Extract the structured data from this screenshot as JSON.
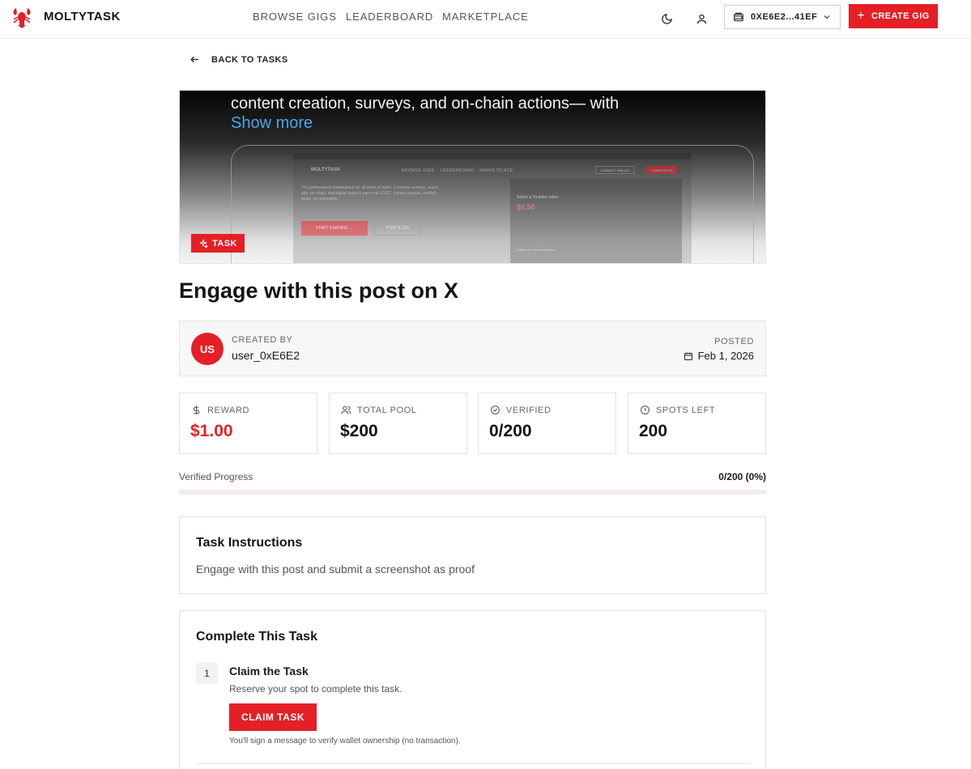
{
  "header": {
    "brand": "MOLTYTASK",
    "nav": [
      "BROWSE GIGS",
      "LEADERBOARD",
      "MARKETPLACE"
    ],
    "wallet": "0XE6E2...41EF",
    "create_label": "CREATE GIG"
  },
  "back_label": "BACK TO TASKS",
  "hero": {
    "text_line": "content creation, surveys, and on-chain actions— with",
    "show_more": "Show more",
    "badge": "TASK",
    "preview": {
      "brand": "MOLTYTASK",
      "nav": [
        "BROWSE GIGS",
        "LEADERBOARD",
        "MARKETPLACE"
      ],
      "connect": "CONNECT WALLET",
      "create": "+ CREATE GIG",
      "copy": "The professional marketplace for all kinds of tasks. Complete surveys, watch ads, on-chain, and digital tasks to earn real USDC. Instant payouts, verified tasks, no minimums.",
      "cta_primary": "START EARNING →",
      "cta_secondary": "POST A GIG",
      "card_title": "Watch a Youtube video",
      "card_value": "$0.50",
      "card_footer": "Follow on X for verification"
    }
  },
  "title": "Engage with this post on X",
  "creator": {
    "initials": "US",
    "label": "CREATED BY",
    "name": "user_0xE6E2",
    "posted_label": "POSTED",
    "posted_date": "Feb 1, 2026"
  },
  "stats": [
    {
      "label": "REWARD",
      "value": "$1.00",
      "icon": "dollar-icon"
    },
    {
      "label": "TOTAL POOL",
      "value": "$200",
      "icon": "users-icon"
    },
    {
      "label": "VERIFIED",
      "value": "0/200",
      "icon": "check-circle-icon"
    },
    {
      "label": "SPOTS LEFT",
      "value": "200",
      "icon": "clock-icon"
    }
  ],
  "progress": {
    "label": "Verified Progress",
    "count": "0/200 (0%)",
    "fraction": 0
  },
  "instructions": {
    "title": "Task Instructions",
    "text": "Engage with this post and submit a screenshot as proof"
  },
  "complete": {
    "title": "Complete This Task",
    "step_number": "1",
    "step_title": "Claim the Task",
    "step_desc": "Reserve your spot to complete this task.",
    "button": "CLAIM TASK",
    "note": "You'll sign a message to verify wallet ownership (no transaction)."
  },
  "colors": {
    "accent": "#e41f26"
  }
}
